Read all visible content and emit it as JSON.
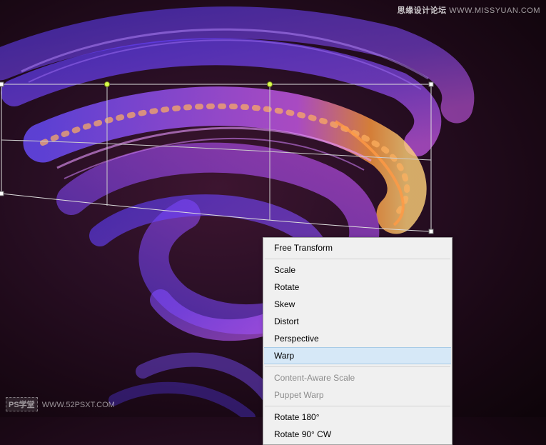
{
  "watermark_top": {
    "brand": "思缘设计论坛",
    "url": "WWW.MISSYUAN.COM"
  },
  "watermark_bottom": {
    "brand": "PS学堂",
    "url": "WWW.52PSXT.COM"
  },
  "context_menu": {
    "free_transform": "Free Transform",
    "scale": "Scale",
    "rotate": "Rotate",
    "skew": "Skew",
    "distort": "Distort",
    "perspective": "Perspective",
    "warp": "Warp",
    "content_aware_scale": "Content-Aware Scale",
    "puppet_warp": "Puppet Warp",
    "rotate_180": "Rotate 180°",
    "rotate_90_cw": "Rotate 90° CW"
  }
}
